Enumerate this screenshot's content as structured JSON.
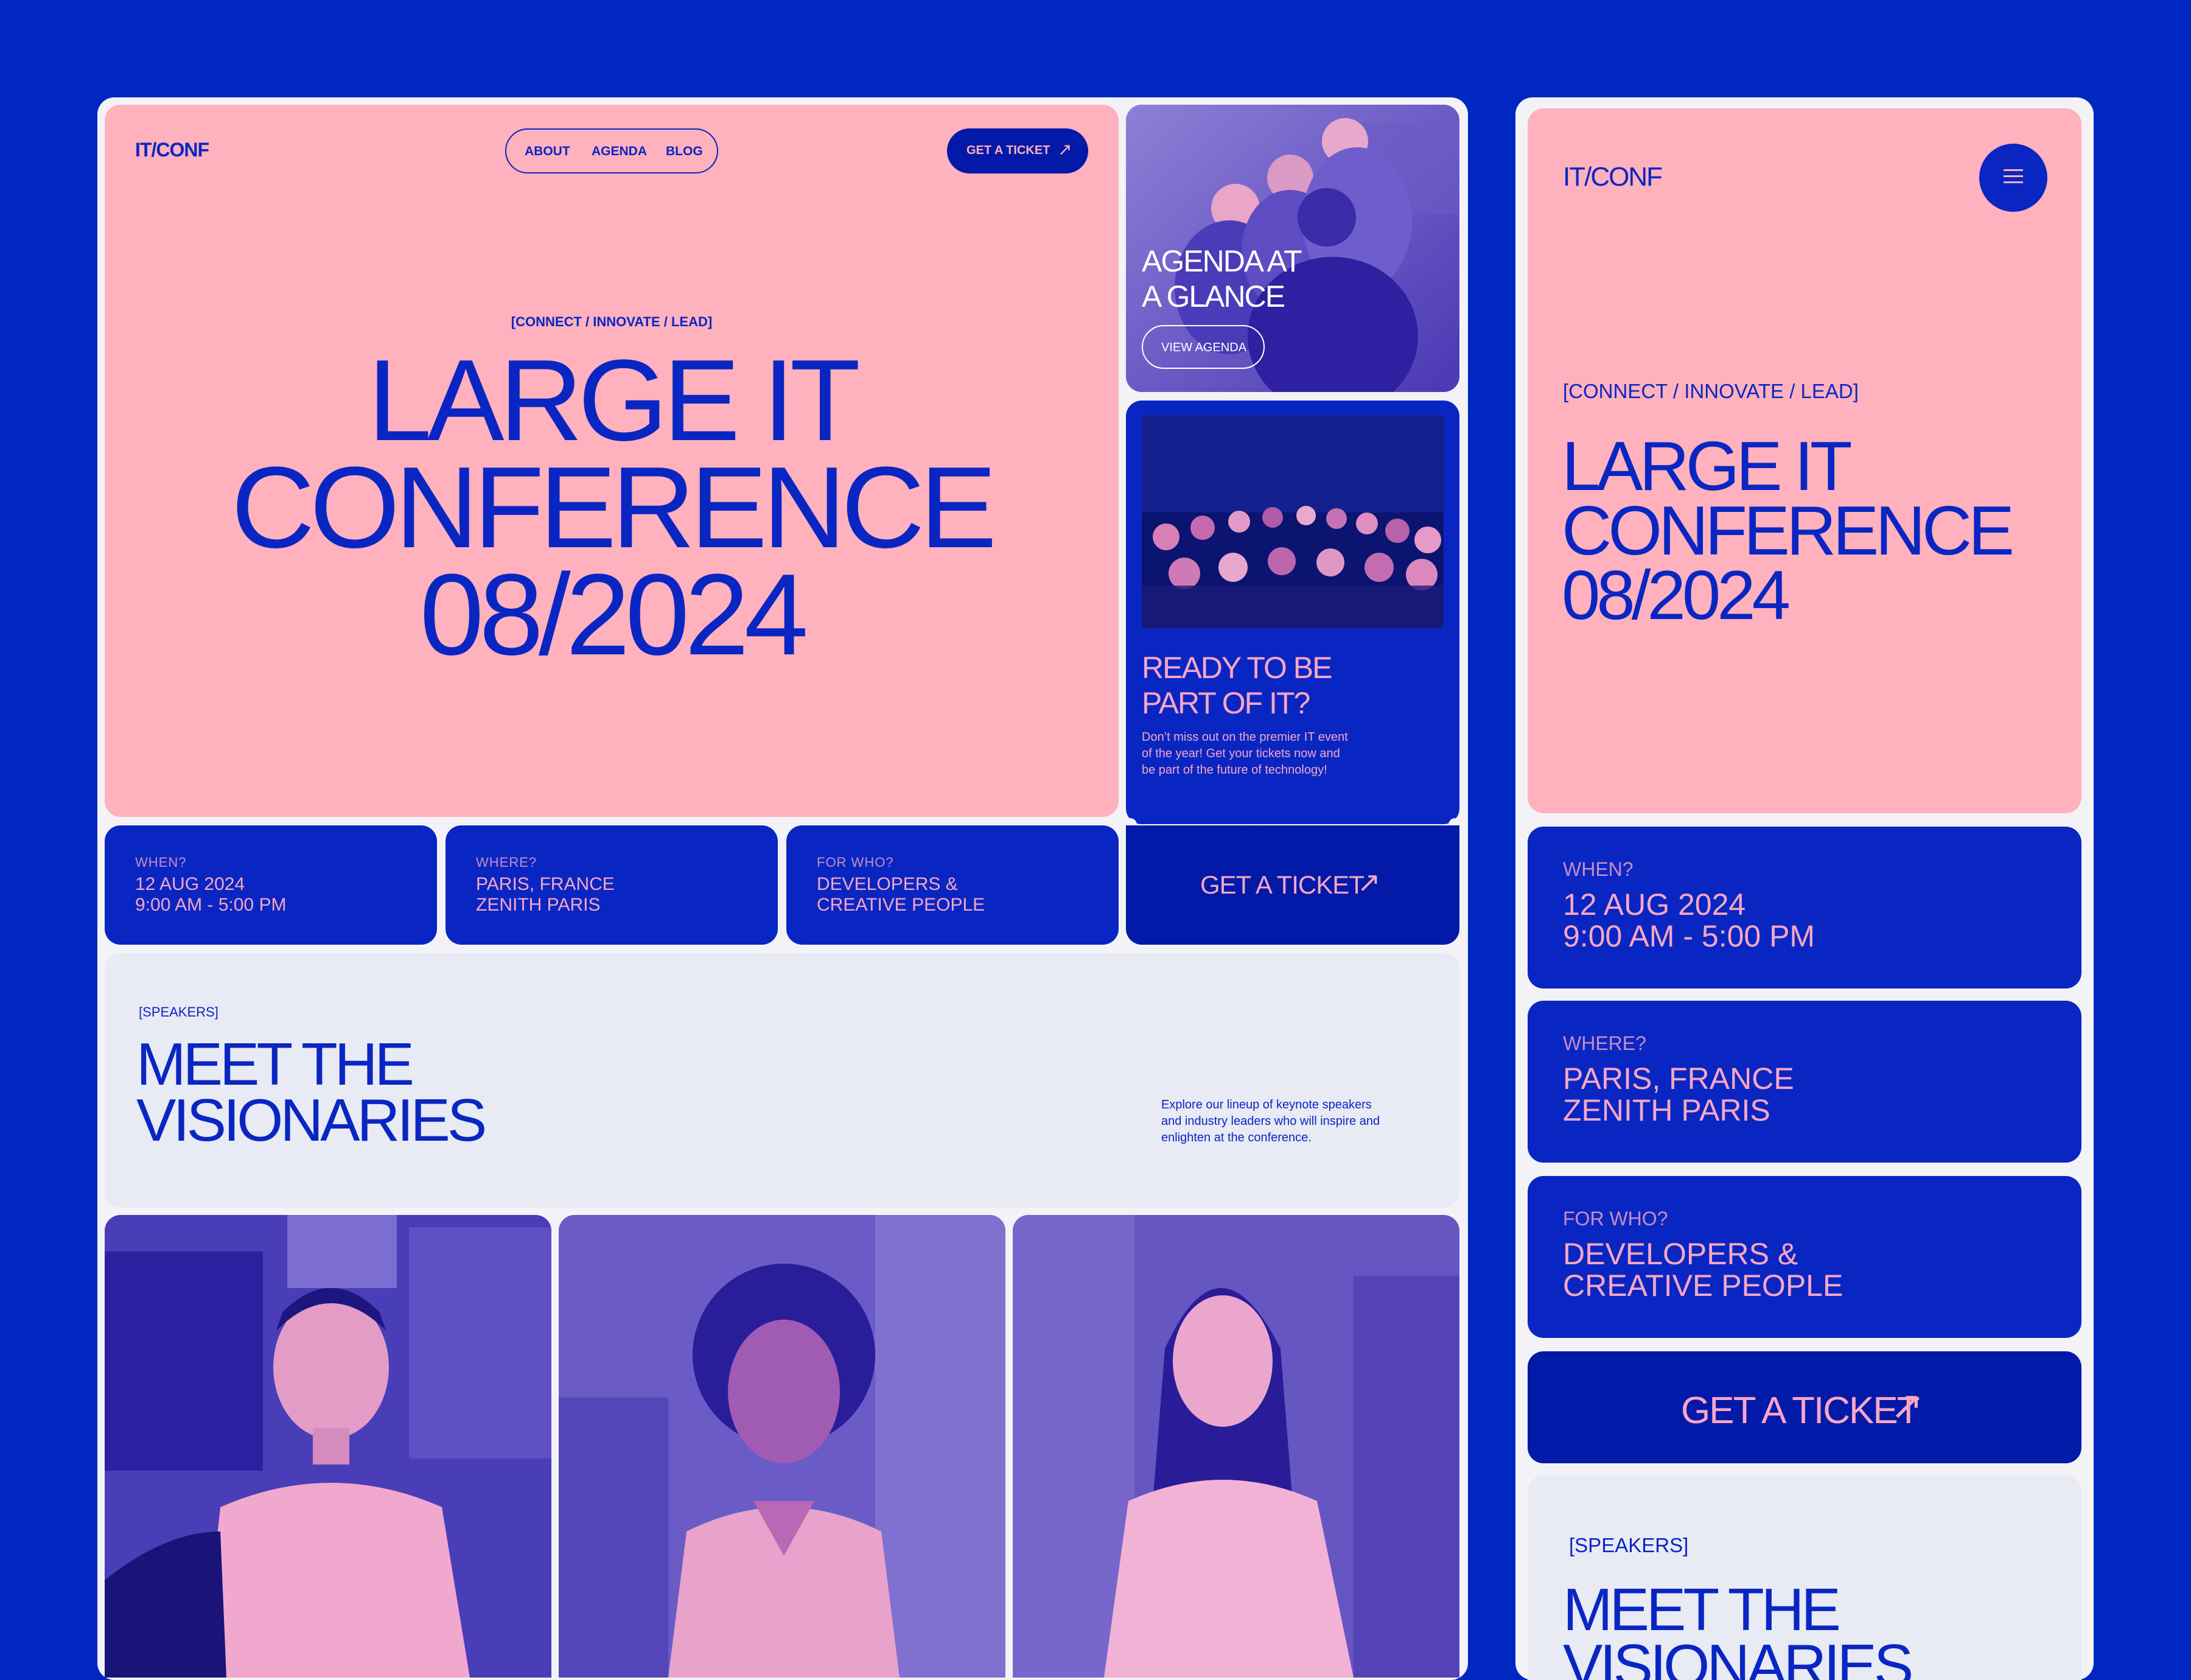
{
  "colors": {
    "background": "#0027C0",
    "pink": "#FFB1BD",
    "blue": "#0A26C2",
    "dark_blue": "#0319A8",
    "grey": "#E8EAF4",
    "frame": "#F3F3F7"
  },
  "desktop": {
    "logo": "IT/CONF",
    "nav": {
      "items": [
        "ABOUT",
        "AGENDA",
        "BLOG"
      ]
    },
    "ticket_button": "GET A TICKET",
    "hero": {
      "tag": "[CONNECT / INNOVATE / LEAD]",
      "title_lines": [
        "LARGE IT",
        "CONFERENCE",
        "08/2024"
      ]
    },
    "agenda_card": {
      "title_lines": [
        "AGENDA AT",
        "A GLANCE"
      ],
      "button": "VIEW AGENDA"
    },
    "ready_card": {
      "title_lines": [
        "READY TO BE",
        "PART OF IT?"
      ],
      "text_lines": [
        "Don’t miss out on the premier IT event",
        "of the year! Get your tickets now and",
        "be part of the future of technology!"
      ]
    },
    "info": [
      {
        "label": "WHEN?",
        "lines": [
          "12 AUG 2024",
          "9:00 AM - 5:00 PM"
        ]
      },
      {
        "label": "WHERE?",
        "lines": [
          "PARIS, FRANCE",
          "ZENITH PARIS"
        ]
      },
      {
        "label": "FOR WHO?",
        "lines": [
          "DEVELOPERS &",
          "CREATIVE PEOPLE"
        ]
      }
    ],
    "get_ticket_cta": "GET A TICKET",
    "speakers": {
      "tag": "[SPEAKERS]",
      "title_lines": [
        "MEET THE",
        "VISIONARIES"
      ],
      "text_lines": [
        "Explore our lineup of keynote speakers",
        "and industry leaders who will inspire and",
        "enlighten at the conference."
      ]
    }
  },
  "mobile": {
    "logo": "IT/CONF",
    "menu_icon": "hamburger-icon",
    "hero": {
      "tag": "[CONNECT / INNOVATE / LEAD]",
      "title_lines": [
        "LARGE IT",
        "CONFERENCE",
        "08/2024"
      ]
    },
    "info": [
      {
        "label": "WHEN?",
        "lines": [
          "12 AUG 2024",
          "9:00 AM - 5:00 PM"
        ]
      },
      {
        "label": "WHERE?",
        "lines": [
          "PARIS, FRANCE",
          "ZENITH PARIS"
        ]
      },
      {
        "label": "FOR WHO?",
        "lines": [
          "DEVELOPERS &",
          "CREATIVE PEOPLE"
        ]
      }
    ],
    "get_ticket_cta": "GET A TICKET",
    "speakers": {
      "tag": "[SPEAKERS]",
      "title_lines": [
        "MEET THE",
        "VISIONARIES"
      ]
    }
  }
}
